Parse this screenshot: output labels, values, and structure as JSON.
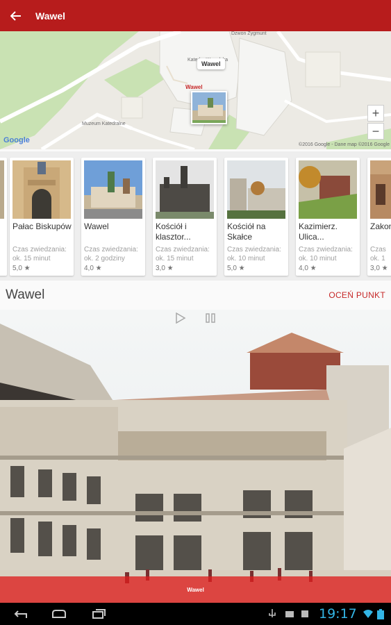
{
  "app_bar": {
    "title": "Wawel"
  },
  "map": {
    "labels": {
      "street": "Dzwon Zygmunt",
      "cathedral": "Katedra Wawelska",
      "museum": "Muzeum Katedralne"
    },
    "marker_label": "Wawel",
    "marker_caption": "Wawel",
    "zoom_in": "+",
    "zoom_out": "−",
    "google": "Google",
    "copyright": "©2016 Google - Dane map ©2016 Google"
  },
  "cards": [
    {
      "title": "Pałac Biskupów",
      "time_label": "Czas zwiedzania:",
      "time": "ok. 15 minut",
      "rating": "5,0 ★"
    },
    {
      "title": "Wawel",
      "time_label": "Czas zwiedzania:",
      "time": "ok. 2 godziny",
      "rating": "4,0 ★"
    },
    {
      "title": "Kościół i klasztor...",
      "time_label": "Czas zwiedzania:",
      "time": "ok. 15 minut",
      "rating": "3,0 ★"
    },
    {
      "title": "Kościół na Skałce",
      "time_label": "Czas zwiedzania:",
      "time": "ok. 10 minut",
      "rating": "5,0 ★"
    },
    {
      "title": "Kazimierz. Ulica...",
      "time_label": "Czas zwiedzania:",
      "time": "ok. 10 minut",
      "rating": "4,0 ★"
    },
    {
      "title": "Zakon Augu...",
      "time_label": "Czas",
      "time": "ok. 1",
      "rating": "3,0 ★"
    }
  ],
  "section": {
    "title": "Wawel",
    "rate_button": "OCEŃ PUNKT"
  },
  "photo": {
    "caption": "Wawel"
  },
  "status_bar": {
    "time": "19:17"
  },
  "colors": {
    "primary": "#b71c1c",
    "accent": "#c62828",
    "clock": "#33b5e5"
  }
}
